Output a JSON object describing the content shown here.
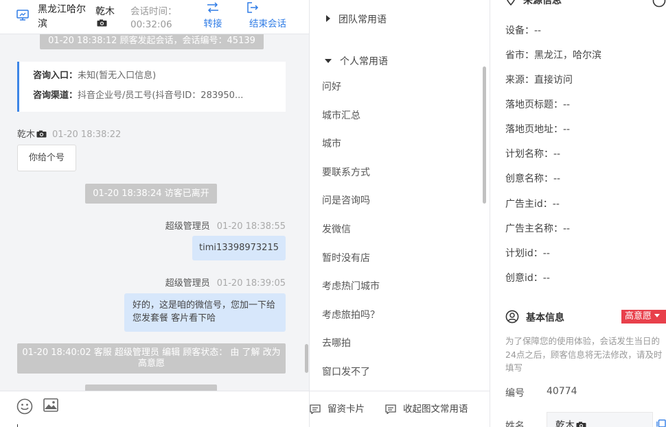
{
  "header": {
    "visitor_name": "黑龙江哈尔滨",
    "agent_name": "乾木",
    "time_label": "会话时间：",
    "time_value": "00:32:06",
    "transfer_label": "转接",
    "end_label": "结束会话"
  },
  "chat": {
    "sys_start": "01-20 18:38:12 顾客发起会话，会话编号：45139",
    "consult_entry_label": "咨询入口：",
    "consult_entry_value": "未知(暂无入口信息)",
    "consult_channel_label": "咨询渠道：",
    "consult_channel_value": "抖音企业号/员工号(抖音号ID：283950...",
    "msg1": {
      "sender": "乾木",
      "time": "01-20 18:38:22",
      "text": "你给个号"
    },
    "sys_left": "01-20 18:38:24 访客已离开",
    "msg2": {
      "sender": "超级管理员",
      "time": "01-20 18:38:55",
      "text": "timi13398973215"
    },
    "msg3": {
      "sender": "超级管理员",
      "time": "01-20 18:39:05",
      "text": "好的，这是咱的微信号，您加一下给您发套餐 客片看下哈"
    },
    "sys_status": "01-20 18:40:02 客服 超级管理员 编辑 顾客状态： 由 了解 改为 高意愿"
  },
  "icons": {
    "monitor": "monitor-icon",
    "camera": "camera-icon",
    "transfer": "transfer-arrows-icon",
    "end": "exit-icon",
    "emoji": "emoji-icon",
    "image": "image-icon",
    "card": "card-icon",
    "collect": "collect-icon",
    "location": "location-pin-icon",
    "user": "user-circle-icon",
    "copy": "copy-icon"
  },
  "phrases": {
    "team_group": "团队常用语",
    "personal_group": "个人常用语",
    "items": [
      "问好",
      "城市汇总",
      "城市",
      "要联系方式",
      "问是咨询吗",
      "发微信",
      "暂时没有店",
      "考虑热门城市",
      "考虑旅拍吗？",
      "去哪拍",
      "窗口发不了"
    ],
    "card_button": "留资卡片",
    "collect_button": "收起图文常用语"
  },
  "info": {
    "source_title": "来源信息",
    "source_fields": [
      {
        "label": "设备：",
        "value": "--"
      },
      {
        "label": "省市：",
        "value": "黑龙江，哈尔滨"
      },
      {
        "label": "来源：",
        "value": "直接访问"
      },
      {
        "label": "落地页标题：",
        "value": "--"
      },
      {
        "label": "落地页地址：",
        "value": "--"
      },
      {
        "label": "计划名称：",
        "value": "--"
      },
      {
        "label": "创意名称：",
        "value": "--"
      },
      {
        "label": "广告主id：",
        "value": "--"
      },
      {
        "label": "广告主名称：",
        "value": "--"
      },
      {
        "label": "计划id：",
        "value": "--"
      },
      {
        "label": "创意id：",
        "value": "--"
      }
    ],
    "basic_title": "基本信息",
    "intent_badge": "高意愿",
    "notice": "为了保障您的使用体验，会话发生当日的24点之后，顾客信息将无法修改，请及时填写",
    "id_label": "编号",
    "id_value": "40774",
    "name_label": "姓名",
    "name_value": "乾木"
  },
  "colors": {
    "accent": "#2f7ce6",
    "badge": "#e8404b",
    "bubble_self": "#d7e7fb",
    "system_pill": "#c8c8c8"
  }
}
